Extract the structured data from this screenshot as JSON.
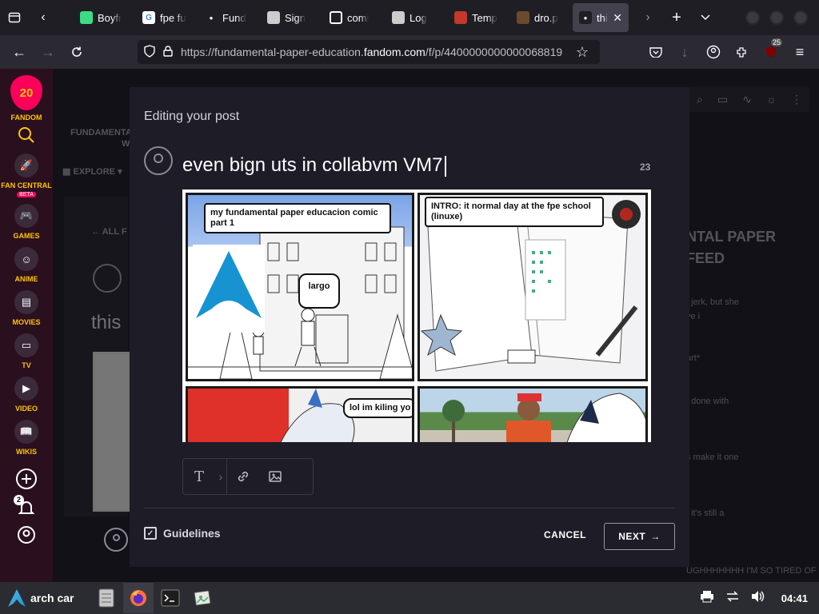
{
  "tabs": [
    {
      "label": "Boyfr",
      "icon": "android-icon",
      "color": "#3ddc84"
    },
    {
      "label": "fpe fu",
      "icon": "google-icon",
      "color": "#ffffff"
    },
    {
      "label": "Fund",
      "icon": "fandom-icon",
      "color": "#ffffff"
    },
    {
      "label": "Sign",
      "icon": "collabvm-icon",
      "color": "#cccccc"
    },
    {
      "label": "comi",
      "icon": "grid-icon",
      "color": "#ffffff"
    },
    {
      "label": "Log",
      "icon": "collabvm-icon",
      "color": "#cccccc"
    },
    {
      "label": "Temp",
      "icon": "red-square-icon",
      "color": "#c0392b"
    },
    {
      "label": "dro.p",
      "icon": "image-icon",
      "color": "#6b4a2b"
    },
    {
      "label": "thi",
      "icon": "fandom-icon",
      "color": "#ffffff",
      "active": true
    }
  ],
  "nav": {
    "url_prefix": "https://fundamental-paper-education.",
    "url_host": "fandom.com",
    "url_path": "/f/p/4400000000000068819",
    "extension_badge": "25"
  },
  "rail": {
    "logo_number": "20",
    "brand": "FANDOM",
    "items": [
      {
        "label": "FAN CENTRAL",
        "icon": "rocket-icon",
        "beta": "BETA"
      },
      {
        "label": "GAMES",
        "icon": "gamepad-icon"
      },
      {
        "label": "ANIME",
        "icon": "anime-face-icon"
      },
      {
        "label": "MOVIES",
        "icon": "clapper-icon"
      },
      {
        "label": "TV",
        "icon": "tv-icon"
      },
      {
        "label": "VIDEO",
        "icon": "play-icon"
      },
      {
        "label": "WIKIS",
        "icon": "book-icon"
      }
    ],
    "notification_count": "2"
  },
  "background": {
    "wiki_name": "FUNDAMENTAL P",
    "wiki_name2": "W",
    "explore": "EXPLORE",
    "all_link": "ALL F",
    "post_title_partial": "this",
    "feed_heading_1": "NTAL PAPER",
    "feed_heading_2": "FEED",
    "feed_items": [
      "t jerk, but she",
      "ve i",
      "art*",
      "t done with",
      "s make it one",
      ", it's still a",
      "UGHHHHHHH I'M SO TIRED OF"
    ]
  },
  "modal": {
    "heading": "Editing your post",
    "title_text": "even bign uts in collabvm VM7",
    "char_count": "23",
    "comic": {
      "panel1_caption": "my fundamental paper educacion comic part 1",
      "panel1_speech": "largo",
      "panel2_caption": "INTRO: it normal day at the fpe school (linuxe)",
      "panel3_speech": "lol im kiling yo"
    },
    "guidelines": "Guidelines",
    "cancel": "CANCEL",
    "next": "NEXT"
  },
  "taskbar": {
    "start_label": "arch car",
    "clock": "04:41"
  }
}
